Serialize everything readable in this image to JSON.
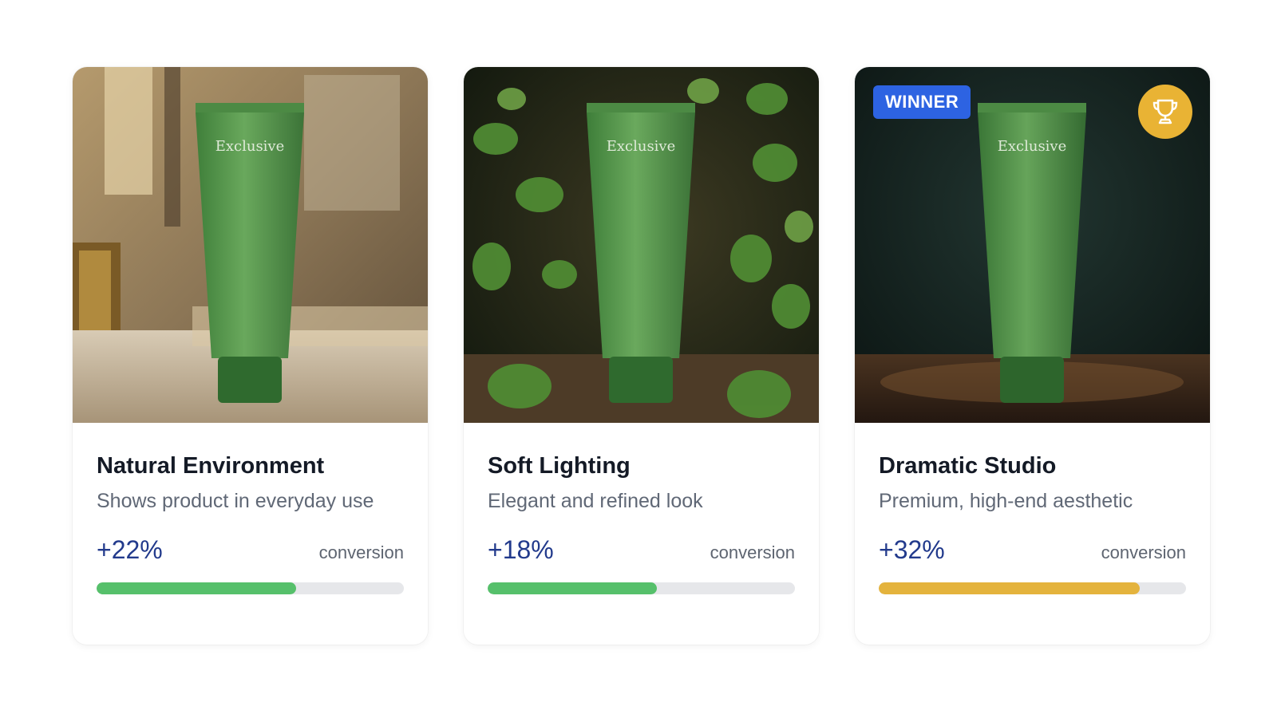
{
  "cards": [
    {
      "title": "Natural Environment",
      "description": "Shows product in everyday use",
      "percent": "+22%",
      "metric_label": "conversion",
      "progress_fraction": 0.65,
      "bar_color": "#56c06b",
      "product_brand": "Exclusive",
      "scene": "marble-sunlit-interior",
      "icon": "product-photo"
    },
    {
      "title": "Soft Lighting",
      "description": "Elegant and refined look",
      "percent": "+18%",
      "metric_label": "conversion",
      "progress_fraction": 0.55,
      "bar_color": "#56c06b",
      "product_brand": "Exclusive",
      "scene": "leafy-forest",
      "icon": "product-photo"
    },
    {
      "title": "Dramatic Studio",
      "description": "Premium, high-end aesthetic",
      "percent": "+32%",
      "metric_label": "conversion",
      "progress_fraction": 0.85,
      "bar_color": "#e4b33d",
      "product_brand": "Exclusive",
      "scene": "dark-studio",
      "badge": "WINNER",
      "badge_color": "#2d63e2",
      "trophy_icon": "trophy-icon",
      "trophy_color": "#e9b334",
      "icon": "product-photo"
    }
  ]
}
